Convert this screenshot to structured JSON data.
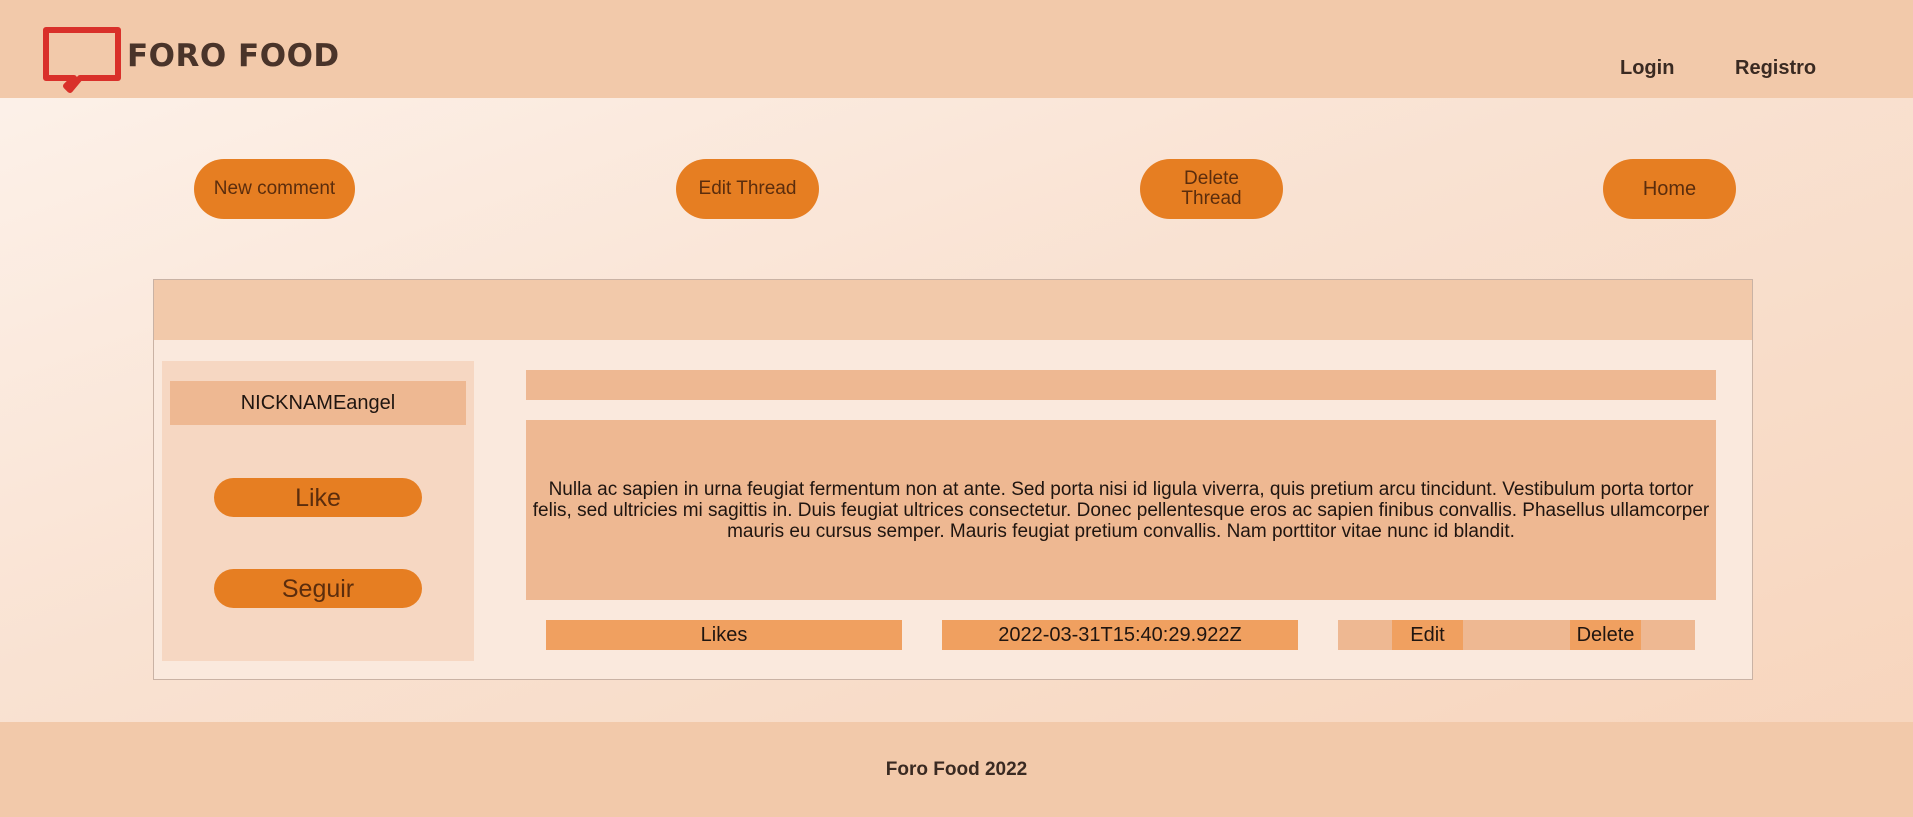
{
  "header": {
    "logo_text": "FORO FOOD",
    "nav": {
      "login": "Login",
      "registro": "Registro"
    }
  },
  "actions": {
    "new_comment": "New comment",
    "edit_thread": "Edit Thread",
    "delete_thread": "Delete Thread",
    "home": "Home"
  },
  "thread": {
    "title": "",
    "author": {
      "nickname": "NICKNAMEangel",
      "like_label": "Like",
      "follow_label": "Seguir"
    },
    "body": "Nulla ac sapien in urna feugiat fermentum non at ante. Sed porta nisi id ligula viverra, quis pretium arcu tincidunt. Vestibulum porta tortor felis, sed ultricies mi sagittis in. Duis feugiat ultrices consectetur. Donec pellentesque eros ac sapien finibus convallis. Phasellus ullamcorper mauris eu cursus semper. Mauris feugiat pretium convallis. Nam porttitor vitae nunc id blandit.",
    "likes_label": "Likes",
    "timestamp": "2022-03-31T15:40:29.922Z",
    "edit_label": "Edit",
    "delete_label": "Delete"
  },
  "footer": {
    "text": "Foro Food 2022"
  },
  "colors": {
    "accent": "#e67e22",
    "header_bg": "#f2c9aa",
    "logo_red": "#d9302a",
    "panel_bg": "#eeb892"
  },
  "icons": {
    "logo": "chat-bubble-icon"
  }
}
